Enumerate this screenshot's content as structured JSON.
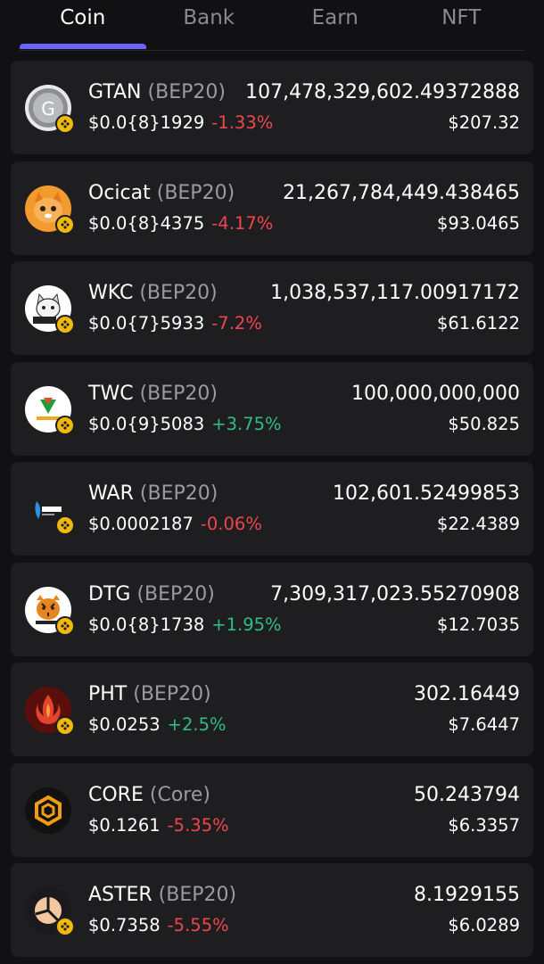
{
  "tabs": [
    {
      "label": "Coin",
      "active": true
    },
    {
      "label": "Bank",
      "active": false
    },
    {
      "label": "Earn",
      "active": false
    },
    {
      "label": "NFT",
      "active": false
    }
  ],
  "colors": {
    "background": "#111113",
    "card": "#1e1e21",
    "accent": "#6c63ff",
    "negative": "#f0454e",
    "positive": "#2ebd85",
    "muted": "#9a9aa2",
    "bnb_badge": "#f0b90b"
  },
  "tokens": [
    {
      "symbol": "GTAN",
      "network": "(BEP20)",
      "price": "$0.0{8}1929",
      "change": "-1.33%",
      "direction": "down",
      "balance": "107,478,329,602.49372888",
      "value": "$207.32",
      "icon": "gtan-coin-icon"
    },
    {
      "symbol": "Ocicat",
      "network": "(BEP20)",
      "price": "$0.0{8}4375",
      "change": "-4.17%",
      "direction": "down",
      "balance": "21,267,784,449.438465",
      "value": "$93.0465",
      "icon": "ocicat-icon"
    },
    {
      "symbol": "WKC",
      "network": "(BEP20)",
      "price": "$0.0{7}5933",
      "change": "-7.2%",
      "direction": "down",
      "balance": "1,038,537,117.00917172",
      "value": "$61.6122",
      "icon": "wkc-icon"
    },
    {
      "symbol": "TWC",
      "network": "(BEP20)",
      "price": "$0.0{9}5083",
      "change": "+3.75%",
      "direction": "up",
      "balance": "100,000,000,000",
      "value": "$50.825",
      "icon": "twc-icon"
    },
    {
      "symbol": "WAR",
      "network": "(BEP20)",
      "price": "$0.0002187",
      "change": "-0.06%",
      "direction": "down",
      "balance": "102,601.52499853",
      "value": "$22.4389",
      "icon": "war-icon"
    },
    {
      "symbol": "DTG",
      "network": "(BEP20)",
      "price": "$0.0{8}1738",
      "change": "+1.95%",
      "direction": "up",
      "balance": "7,309,317,023.55270908",
      "value": "$12.7035",
      "icon": "dtg-tiger-icon"
    },
    {
      "symbol": "PHT",
      "network": "(BEP20)",
      "price": "$0.0253",
      "change": "+2.5%",
      "direction": "up",
      "balance": "302.16449",
      "value": "$7.6447",
      "icon": "pht-phoenix-icon"
    },
    {
      "symbol": "CORE",
      "network": "(Core)",
      "price": "$0.1261",
      "change": "-5.35%",
      "direction": "down",
      "balance": "50.243794",
      "value": "$6.3357",
      "icon": "core-icon"
    },
    {
      "symbol": "ASTER",
      "network": "(BEP20)",
      "price": "$0.7358",
      "change": "-5.55%",
      "direction": "down",
      "balance": "8.1929155",
      "value": "$6.0289",
      "icon": "aster-icon"
    }
  ]
}
